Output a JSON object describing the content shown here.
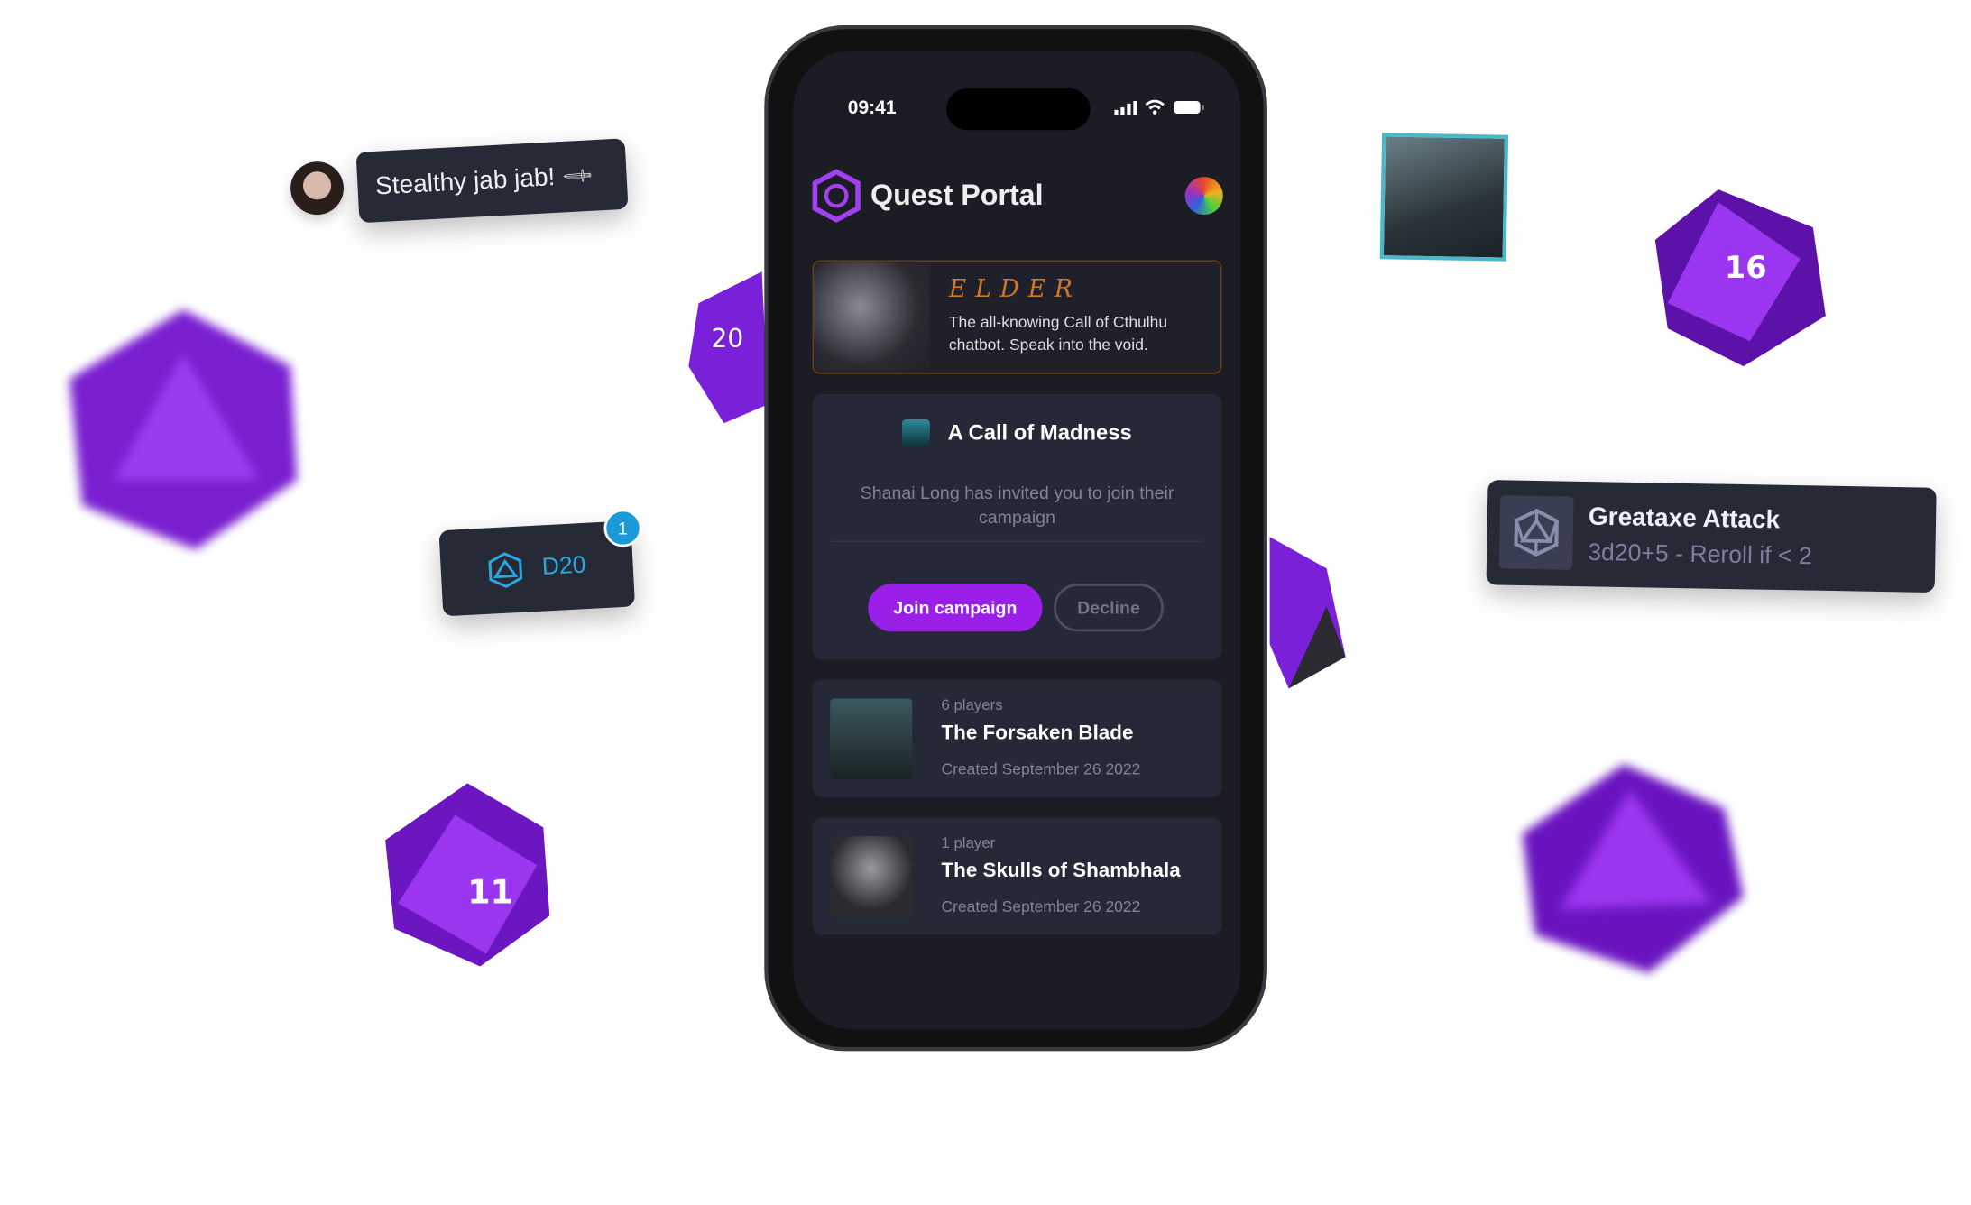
{
  "status": {
    "time": "09:41"
  },
  "app": {
    "title": "Quest Portal",
    "accent": "#9b1fe8"
  },
  "elder": {
    "title": "ELDER",
    "description": "The all-knowing Call of Cthulhu chatbot. Speak into the void."
  },
  "invite": {
    "title": "A Call of Madness",
    "message": "Shanai Long has invited you to join their campaign",
    "join_label": "Join campaign",
    "decline_label": "Decline"
  },
  "campaigns": [
    {
      "players": "6 players",
      "name": "The Forsaken Blade",
      "created": "Created September 26 2022"
    },
    {
      "players": "1 player",
      "name": "The Skulls of Shambhala",
      "created": "Created September 26 2022"
    }
  ],
  "chat": {
    "message": "Stealthy jab jab!",
    "icon": "knife-icon"
  },
  "dice_card": {
    "label": "D20",
    "badge": "1",
    "icon": "d20-icon"
  },
  "attack": {
    "title": "Greataxe Attack",
    "formula": "3d20+5 - Reroll if < 2",
    "icon": "d20-icon"
  }
}
